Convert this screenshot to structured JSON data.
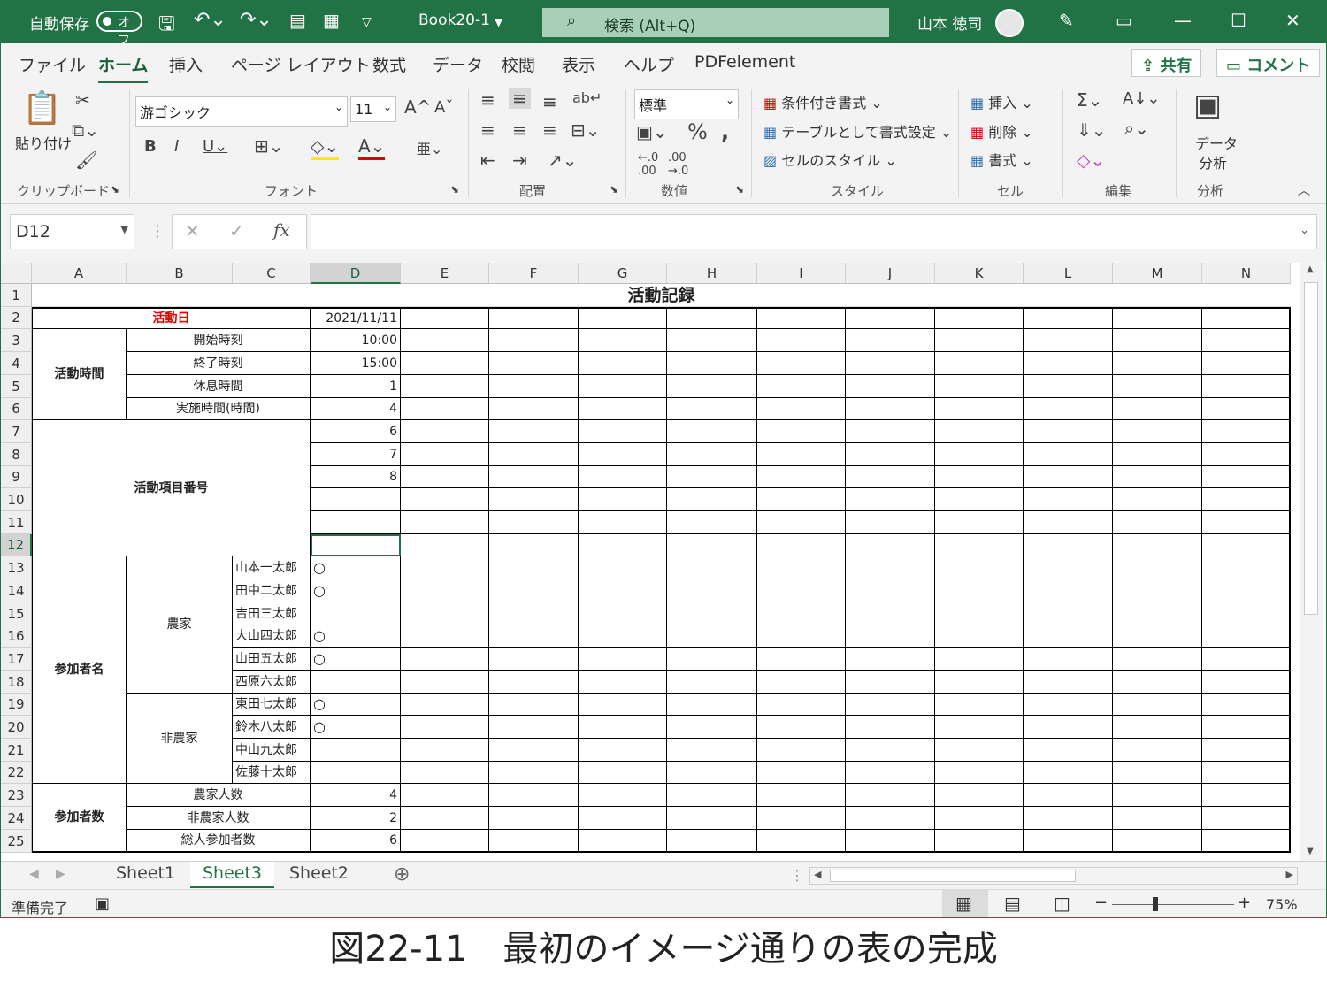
{
  "titlebar": {
    "autosave_label": "自動保存",
    "autosave_state": "オフ",
    "filename": "Book20-1",
    "search_placeholder": "検索 (Alt+Q)",
    "user_name": "山本 徳司"
  },
  "tabs": [
    "ファイル",
    "ホーム",
    "挿入",
    "ページ レイアウト",
    "数式",
    "データ",
    "校閲",
    "表示",
    "ヘルプ",
    "PDFelement"
  ],
  "active_tab": "ホーム",
  "share_label": "共有",
  "comment_label": "コメント",
  "ribbon": {
    "paste_label": "貼り付け",
    "font_name": "游ゴシック",
    "font_size": "11",
    "number_format": "標準",
    "cond_format": "条件付き書式",
    "table_format": "テーブルとして書式設定",
    "cell_styles": "セルのスタイル",
    "insert": "挿入",
    "delete": "削除",
    "format": "書式",
    "analyze_line1": "データ",
    "analyze_line2": "分析",
    "groups": {
      "clipboard": "クリップボード",
      "font": "フォント",
      "alignment": "配置",
      "number": "数値",
      "styles": "スタイル",
      "cells": "セル",
      "editing": "編集",
      "analysis": "分析"
    }
  },
  "formula_bar": {
    "name_box": "D12",
    "formula": ""
  },
  "columns": [
    "A",
    "B",
    "C",
    "D",
    "E",
    "F",
    "G",
    "H",
    "I",
    "J",
    "K",
    "L",
    "M",
    "N"
  ],
  "rows": [
    "1",
    "2",
    "3",
    "4",
    "5",
    "6",
    "7",
    "8",
    "9",
    "10",
    "11",
    "12",
    "13",
    "14",
    "15",
    "16",
    "17",
    "18",
    "19",
    "20",
    "21",
    "22",
    "23",
    "24",
    "25"
  ],
  "sheet": {
    "title": "活動記録",
    "date_label": "活動日",
    "date_value": "2021/11/11",
    "time_group": "活動時間",
    "start_label": "開始時刻",
    "start_value": "10:00",
    "end_label": "終了時刻",
    "end_value": "15:00",
    "break_label": "休息時間",
    "break_value": "1",
    "duration_label": "実施時間(時間)",
    "duration_value": "4",
    "item_group": "活動項目番号",
    "items": [
      "6",
      "7",
      "8",
      "",
      "",
      ""
    ],
    "participants_group": "参加者名",
    "farmer_label": "農家",
    "nonfarmer_label": "非農家",
    "participants": [
      {
        "name": "山本一太郎",
        "mark": "○"
      },
      {
        "name": "田中二太郎",
        "mark": "○"
      },
      {
        "name": "吉田三太郎",
        "mark": ""
      },
      {
        "name": "大山四太郎",
        "mark": "○"
      },
      {
        "name": "山田五太郎",
        "mark": "○"
      },
      {
        "name": "西原六太郎",
        "mark": ""
      },
      {
        "name": "東田七太郎",
        "mark": "○"
      },
      {
        "name": "鈴木八太郎",
        "mark": "○"
      },
      {
        "name": "中山九太郎",
        "mark": ""
      },
      {
        "name": "佐藤十太郎",
        "mark": ""
      }
    ],
    "count_group": "参加者数",
    "farmer_count_label": "農家人数",
    "farmer_count": "4",
    "nonfarmer_count_label": "非農家人数",
    "nonfarmer_count": "2",
    "total_label": "総人参加者数",
    "total_count": "6"
  },
  "sheet_tabs": [
    "Sheet1",
    "Sheet3",
    "Sheet2"
  ],
  "active_sheet": "Sheet3",
  "status": {
    "ready": "準備完了",
    "zoom": "75%"
  },
  "caption": "図22-11　最初のイメージ通りの表の完成",
  "colors": {
    "accent": "#217346",
    "red_text": "#e00000"
  }
}
